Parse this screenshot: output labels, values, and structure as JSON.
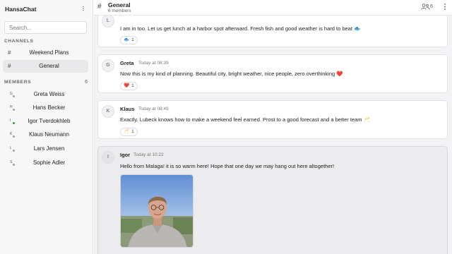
{
  "app": {
    "title": "HansaChat",
    "more_icon": "kebab-icon"
  },
  "search": {
    "placeholder": "Search...",
    "value": ""
  },
  "sidebar": {
    "channels_heading": "CHANNELS",
    "channels": [
      {
        "label": "Weekend Plans",
        "icon": "hash-icon",
        "active": false
      },
      {
        "label": "General",
        "icon": "hash-icon",
        "active": true
      }
    ],
    "members_heading": "MEMBERS",
    "members_count": "6",
    "members": [
      {
        "initial": "G",
        "name": "Greta Weiss",
        "status": "offline"
      },
      {
        "initial": "H",
        "name": "Hans Becker",
        "status": "offline"
      },
      {
        "initial": "I",
        "name": "Igor Tverdokhleb",
        "status": "online"
      },
      {
        "initial": "K",
        "name": "Klaus Neumann",
        "status": "offline"
      },
      {
        "initial": "L",
        "name": "Lars Jensen",
        "status": "offline"
      },
      {
        "initial": "S",
        "name": "Sophie Adler",
        "status": "offline"
      }
    ]
  },
  "header": {
    "channel_name": "General",
    "subtitle": "6 members",
    "members_count": "6",
    "members_icon": "people-icon",
    "menu_icon": "kebab-icon"
  },
  "messages": [
    {
      "avatar": "L",
      "author": "",
      "time": "",
      "text": "I am in too. Let us get lunch at a harbor spot afterward. Fresh fish and good weather is hard to beat 🐟",
      "reaction": {
        "emoji": "🐟",
        "count": "1"
      }
    },
    {
      "avatar": "G",
      "author": "Greta",
      "time": "Today at 08:39",
      "text": "Now this is my kind of planning. Beautiful city, bright weather, nice people, zero overthinking ❤️",
      "reaction": {
        "emoji": "❤️",
        "count": "1"
      }
    },
    {
      "avatar": "K",
      "author": "Klaus",
      "time": "Today at 08:49",
      "text": "Exactly. Lubeck knows how to make a weekend feel earned. Prost to a good forecast and a better team 🥂",
      "reaction": {
        "emoji": "🥂",
        "count": "1"
      }
    },
    {
      "avatar": "I",
      "author": "Igor",
      "time": "Today at 10:22",
      "text": "Hello from Malaga! it is so warm here! Hope that one day we may hang out here altogether!",
      "attachment": "photo-of-person-outdoors"
    }
  ],
  "colors": {
    "sidebar_bg": "#f7f7f8",
    "main_bg": "#f3f3f5",
    "active_channel_bg": "#e8e8ea",
    "online": "#2ea44f",
    "heart": "#e0245e"
  }
}
